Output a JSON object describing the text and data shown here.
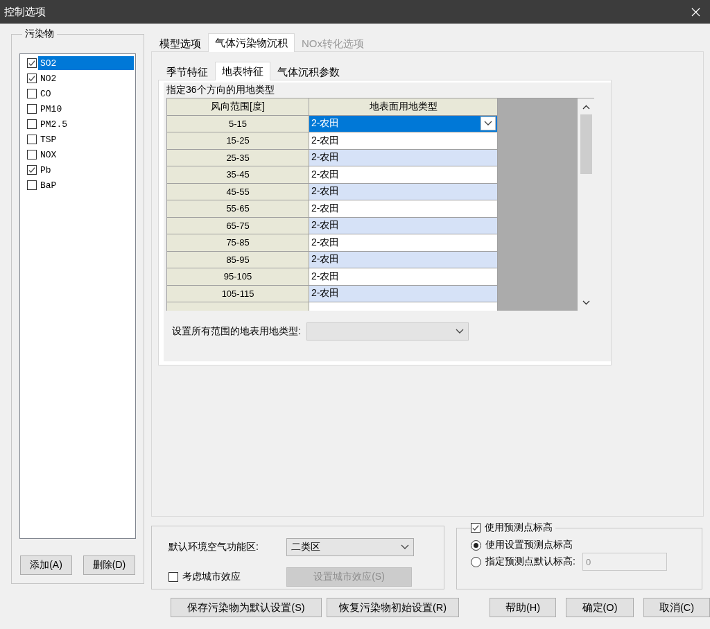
{
  "window": {
    "title": "控制选项"
  },
  "pollutants": {
    "title": "污染物",
    "items": [
      {
        "label": "SO2",
        "checked": true,
        "selected": true
      },
      {
        "label": "NO2",
        "checked": true,
        "selected": false
      },
      {
        "label": "CO",
        "checked": false,
        "selected": false
      },
      {
        "label": "PM10",
        "checked": false,
        "selected": false
      },
      {
        "label": "PM2.5",
        "checked": false,
        "selected": false
      },
      {
        "label": "TSP",
        "checked": false,
        "selected": false
      },
      {
        "label": "NOX",
        "checked": false,
        "selected": false
      },
      {
        "label": "Pb",
        "checked": true,
        "selected": false
      },
      {
        "label": "BaP",
        "checked": false,
        "selected": false
      }
    ],
    "buttons": [
      "添加(A)",
      "删除(D)"
    ]
  },
  "tabs": [
    {
      "label": "模型选项",
      "selected": false,
      "disabled": false
    },
    {
      "label": "气体污染物沉积",
      "selected": true,
      "disabled": false
    },
    {
      "label": "NOx转化选项",
      "selected": false,
      "disabled": true
    }
  ],
  "sub_tabs": [
    {
      "label": "季节特征",
      "selected": false
    },
    {
      "label": "地表特征",
      "selected": true
    },
    {
      "label": "气体沉积参数",
      "selected": false
    }
  ],
  "land_use": {
    "title": "指定36个方向的用地类型",
    "columns": [
      "风向范围[度]",
      "地表面用地类型"
    ],
    "rows": [
      {
        "range": "5-15",
        "type": "2-农田",
        "selected": true
      },
      {
        "range": "15-25",
        "type": "2-农田",
        "selected": false
      },
      {
        "range": "25-35",
        "type": "2-农田",
        "selected": false
      },
      {
        "range": "35-45",
        "type": "2-农田",
        "selected": false
      },
      {
        "range": "45-55",
        "type": "2-农田",
        "selected": false
      },
      {
        "range": "55-65",
        "type": "2-农田",
        "selected": false
      },
      {
        "range": "65-75",
        "type": "2-农田",
        "selected": false
      },
      {
        "range": "75-85",
        "type": "2-农田",
        "selected": false
      },
      {
        "range": "85-95",
        "type": "2-农田",
        "selected": false
      },
      {
        "range": "95-105",
        "type": "2-农田",
        "selected": false
      },
      {
        "range": "105-115",
        "type": "2-农田",
        "selected": false
      }
    ],
    "set_all": {
      "label": "设置所有范围的地表用地类型:",
      "disabled": true
    }
  },
  "air_zone": {
    "label": "默认环境空气功能区:",
    "value": "二类区"
  },
  "urban": {
    "label": "考虑城市效应",
    "checked": false
  },
  "urban_button": {
    "label": "设置城市效应(S)",
    "disabled": true
  },
  "elevation": {
    "label": "使用预测点标高",
    "checked": true,
    "options": [
      {
        "label": "使用设置预测点标高",
        "selected": true
      },
      {
        "label": "指定预测点默认标高:",
        "selected": false
      }
    ],
    "default_value": "0",
    "disabled": true
  },
  "footer_buttons": [
    "保存污染物为默认设置(S)",
    "恢复污染物初始设置(R)",
    "帮助(H)",
    "确定(O)",
    "取消(C)"
  ]
}
